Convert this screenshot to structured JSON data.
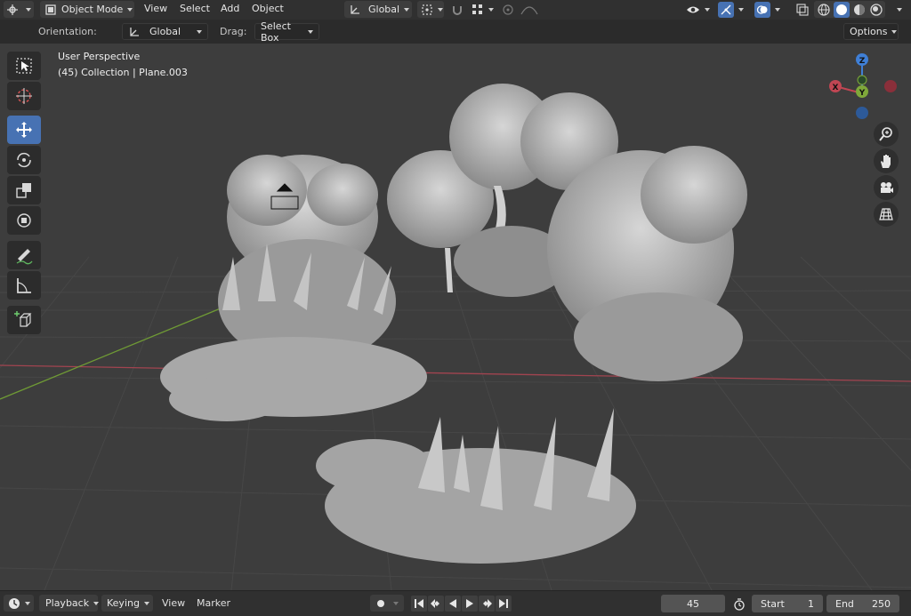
{
  "header": {
    "editor_type_icon": "3d-viewport-icon",
    "mode_label": "Object Mode",
    "menus": [
      "View",
      "Select",
      "Add",
      "Object"
    ],
    "transform_orientation": "Global"
  },
  "tool_settings": {
    "orientation_label": "Orientation:",
    "orientation_value": "Global",
    "drag_label": "Drag:",
    "drag_value": "Select Box",
    "options_label": "Options"
  },
  "viewport": {
    "view_name": "User Perspective",
    "collection_info": "(45) Collection | Plane.003",
    "gizmo_axes": {
      "x": "X",
      "y": "Y",
      "z": "Z"
    },
    "colors": {
      "background": "#3d3d3d",
      "x_axis": "#c04653",
      "y_axis": "#7fa83a",
      "z_axis": "#3f7fd6",
      "grid": "#4a4a4a",
      "foliage": "#bdbdbd"
    }
  },
  "toolbox": {
    "tools": [
      {
        "name": "select-box-tool",
        "icon": "select-box-icon",
        "active": false
      },
      {
        "name": "cursor-tool",
        "icon": "cursor-icon",
        "active": false
      },
      {
        "name": "move-tool",
        "icon": "move-icon",
        "active": true
      },
      {
        "name": "rotate-tool",
        "icon": "rotate-icon",
        "active": false
      },
      {
        "name": "scale-tool",
        "icon": "scale-icon",
        "active": false
      },
      {
        "name": "transform-tool",
        "icon": "transform-icon",
        "active": false
      },
      {
        "name": "annotate-tool",
        "icon": "annotate-icon",
        "active": false
      },
      {
        "name": "measure-tool",
        "icon": "measure-icon",
        "active": false
      },
      {
        "name": "add-cube-tool",
        "icon": "add-cube-icon",
        "active": false
      }
    ]
  },
  "timeline": {
    "playback_label": "Playback",
    "keying_label": "Keying",
    "view_label": "View",
    "marker_label": "Marker",
    "current_frame": "45",
    "start_label": "Start",
    "start_value": "1",
    "end_label": "End",
    "end_value": "250"
  }
}
